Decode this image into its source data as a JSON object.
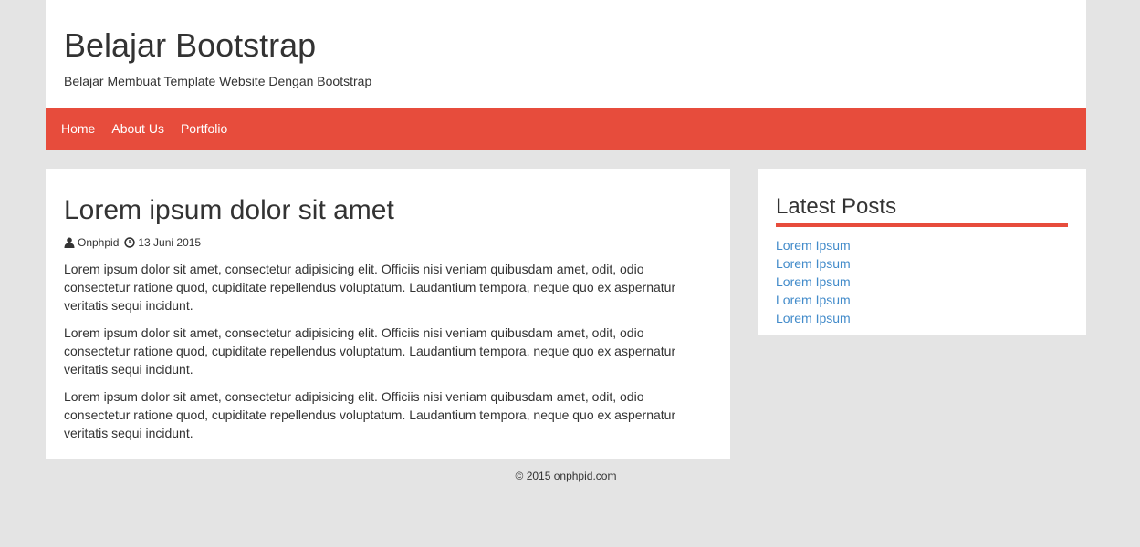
{
  "header": {
    "title": "Belajar Bootstrap",
    "description": "Belajar Membuat Template Website Dengan Bootstrap"
  },
  "nav": {
    "items": [
      {
        "label": "Home"
      },
      {
        "label": "About Us"
      },
      {
        "label": "Portfolio"
      }
    ]
  },
  "post": {
    "title": "Lorem ipsum dolor sit amet",
    "author": "Onphpid",
    "author_icon": "user-icon",
    "date": "13 Juni 2015",
    "date_icon": "clock-icon",
    "paragraphs": [
      "Lorem ipsum dolor sit amet, consectetur adipisicing elit. Officiis nisi veniam quibusdam amet, odit, odio consectetur ratione quod, cupiditate repellendus voluptatum. Laudantium tempora, neque quo ex aspernatur veritatis sequi incidunt.",
      "Lorem ipsum dolor sit amet, consectetur adipisicing elit. Officiis nisi veniam quibusdam amet, odit, odio consectetur ratione quod, cupiditate repellendus voluptatum. Laudantium tempora, neque quo ex aspernatur veritatis sequi incidunt.",
      "Lorem ipsum dolor sit amet, consectetur adipisicing elit. Officiis nisi veniam quibusdam amet, odit, odio consectetur ratione quod, cupiditate repellendus voluptatum. Laudantium tempora, neque quo ex aspernatur veritatis sequi incidunt."
    ]
  },
  "sidebar": {
    "title": "Latest Posts",
    "links": [
      {
        "label": "Lorem Ipsum"
      },
      {
        "label": "Lorem Ipsum"
      },
      {
        "label": "Lorem Ipsum"
      },
      {
        "label": "Lorem Ipsum"
      },
      {
        "label": "Lorem Ipsum"
      }
    ]
  },
  "footer": {
    "copyright": "© 2015 onphpid.com"
  },
  "colors": {
    "accent": "#e74c3c",
    "link": "#428bca",
    "background": "#e4e4e4",
    "text": "#333333"
  }
}
